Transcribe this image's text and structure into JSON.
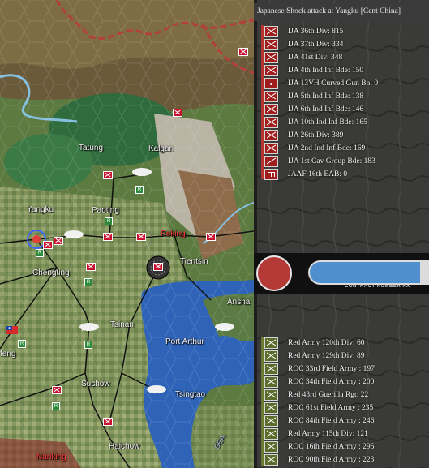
{
  "map": {
    "cities": [
      {
        "id": "tatung",
        "name": "Tatung",
        "red": false
      },
      {
        "id": "kalgan",
        "name": "Kalgan",
        "red": false
      },
      {
        "id": "yangku",
        "name": "Yangku",
        "red": false
      },
      {
        "id": "paoting",
        "name": "Paoting",
        "red": false
      },
      {
        "id": "peking",
        "name": "Peking",
        "red": true
      },
      {
        "id": "chengting",
        "name": "Chengting",
        "red": false
      },
      {
        "id": "tientsin",
        "name": "Tientsin",
        "red": false
      },
      {
        "id": "ansha",
        "name": "Ansha",
        "red": false
      },
      {
        "id": "tsinan",
        "name": "Tsinan",
        "red": false
      },
      {
        "id": "port-arthur",
        "name": "Port Arthur",
        "red": false
      },
      {
        "id": "feng",
        "name": "feng",
        "red": false
      },
      {
        "id": "suchow",
        "name": "Suchow",
        "red": false
      },
      {
        "id": "tsingtao",
        "name": "Tsingtao",
        "red": false
      },
      {
        "id": "haichow",
        "name": "Haichow",
        "red": false
      },
      {
        "id": "nanking",
        "name": "Nanking",
        "red": true
      }
    ],
    "sea_label": "SEA"
  },
  "combat": {
    "title": "Japanese Shock attack at Yangku [Cent China]",
    "attacker_units": [
      {
        "icon": "x",
        "label": "IJA 36th Div: 815"
      },
      {
        "icon": "x",
        "label": "IJA 37th Div: 334"
      },
      {
        "icon": "x",
        "label": "IJA 41st Div: 348"
      },
      {
        "icon": "x",
        "label": "IJA 4th Ind Inf Bde: 150"
      },
      {
        "icon": "dot",
        "label": "IJA 13VH Curved Gun Bn: 0"
      },
      {
        "icon": "x",
        "label": "IJA 5th Ind Inf Bde: 138"
      },
      {
        "icon": "x",
        "label": "IJA 6th Ind Inf Bde: 146"
      },
      {
        "icon": "x",
        "label": "IJA 10th Ind Inf Bde: 165"
      },
      {
        "icon": "x",
        "label": "IJA 26th Div: 389"
      },
      {
        "icon": "x",
        "label": "IJA 2nd Ind Inf Bde: 169"
      },
      {
        "icon": "slash",
        "label": "IJA 1st Cav Group Bde: 183"
      },
      {
        "icon": "eng",
        "label": "JAAF 16th EAB: 0"
      }
    ],
    "defender_units": [
      {
        "icon": "x",
        "label": "Red Army 120th Div: 60"
      },
      {
        "icon": "x",
        "label": "Red Army 129th Div: 89"
      },
      {
        "icon": "x",
        "label": "ROC 33rd Field Army : 197"
      },
      {
        "icon": "x",
        "label": "ROC 34th Field Army : 200"
      },
      {
        "icon": "x",
        "label": "Red 43rd Guerilla Rgt: 22"
      },
      {
        "icon": "x",
        "label": "ROC 61st Field Army : 235"
      },
      {
        "icon": "x",
        "label": "ROC 84th Field Army : 246"
      },
      {
        "icon": "x",
        "label": "Red Army 115th Div: 121"
      },
      {
        "icon": "x",
        "label": "ROC 16th Field Army : 295"
      },
      {
        "icon": "x",
        "label": "ROC 90th Field Army : 223"
      }
    ],
    "contract_label": "CONTRACT NUMBER   NX",
    "battle_progress": 0.94,
    "colors": {
      "attacker": "#9f1d1d",
      "defender": "#5b6b2b",
      "attack_circle": "#b33a36",
      "progress": "#4f8fd0"
    }
  }
}
